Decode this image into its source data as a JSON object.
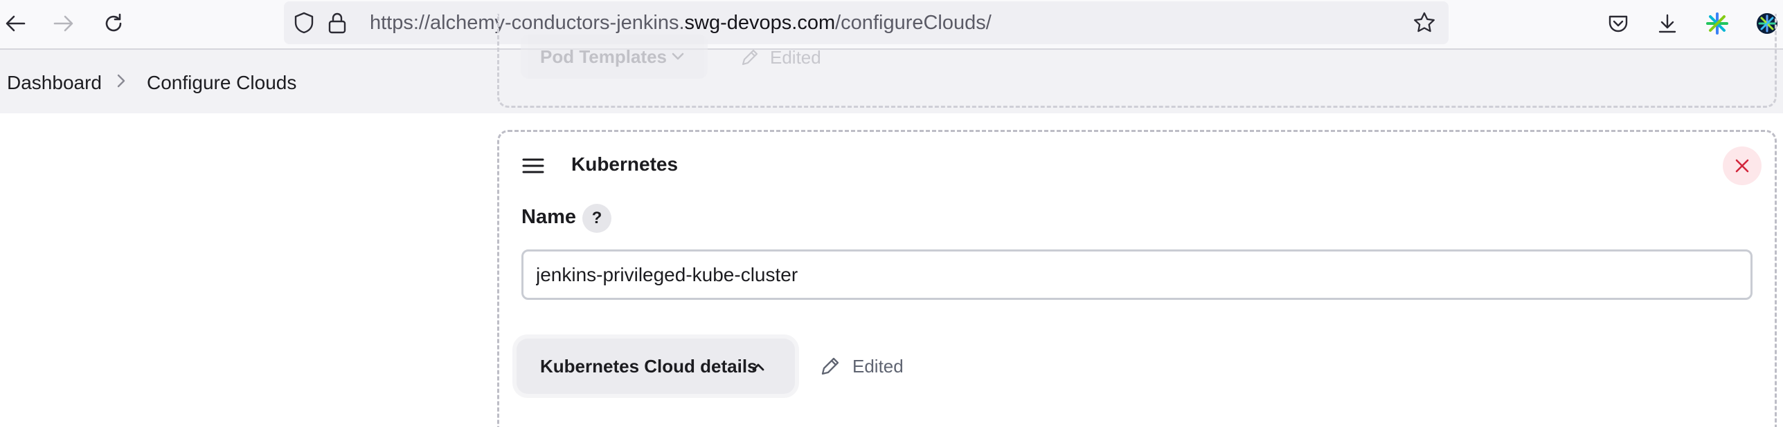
{
  "browser": {
    "url_prefix": "https://alchemy-conductors-jenkins.",
    "url_host": "swg-devops.com",
    "url_path": "/configureClouds/"
  },
  "breadcrumb": {
    "items": [
      "Dashboard",
      "Configure Clouds"
    ]
  },
  "previous_section": {
    "pill_label": "Pod Templates",
    "edited_label": "Edited"
  },
  "cloud": {
    "title": "Kubernetes",
    "name_label": "Name",
    "help_label": "?",
    "name_value": "jenkins-privileged-kube-cluster",
    "details_label": "Kubernetes Cloud details",
    "edited_label": "Edited"
  },
  "colors": {
    "close_bg": "#fde7ea",
    "close_icon": "#d2263c",
    "pill_bg": "#ebebef"
  }
}
